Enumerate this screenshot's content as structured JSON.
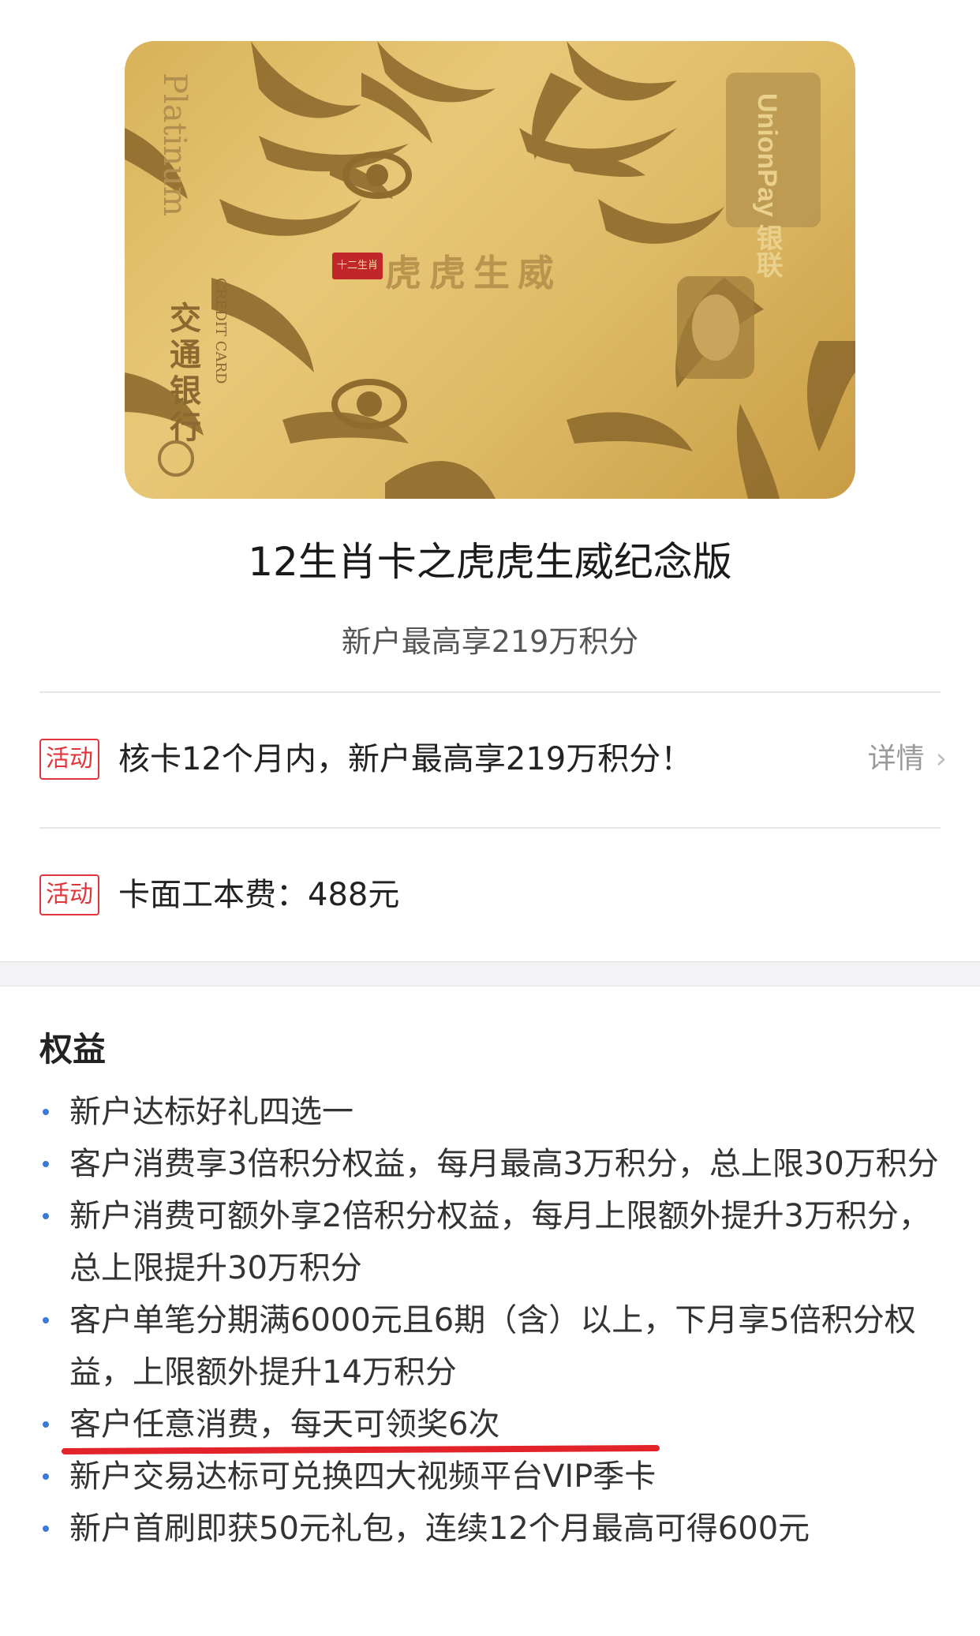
{
  "card": {
    "platinum": "Platinum",
    "bank_name": "交通银行",
    "credit_line": "CREDIT CARD",
    "seal": "十二生肖",
    "motto": "虎虎生威",
    "unionpay": "UnionPay 银联"
  },
  "product": {
    "title": "12生肖卡之虎虎生威纪念版",
    "subtitle": "新户最高享219万积分"
  },
  "activities": [
    {
      "tag": "活动",
      "text": "核卡12个月内，新户最高享219万积分！",
      "detail": "详情"
    },
    {
      "tag": "活动",
      "text": "卡面工本费：488元"
    }
  ],
  "benefits": {
    "title": "权益",
    "items": [
      "新户达标好礼四选一",
      "客户消费享3倍积分权益，每月最高3万积分，总上限30万积分",
      "新户消费可额外享2倍积分权益，每月上限额外提升3万积分，总上限提升30万积分",
      "客户单笔分期满6000元且6期（含）以上，下月享5倍积分权益，上限额外提升14万积分",
      "客户任意消费，每天可领奖6次",
      "新户交易达标可兑换四大视频平台VIP季卡",
      "新户首刷即获50元礼包，连续12个月最高可得600元"
    ]
  },
  "colors": {
    "accent_red": "#e0353b",
    "bullet_blue": "#3a7bd5",
    "card_gold": "#dfbb68"
  }
}
